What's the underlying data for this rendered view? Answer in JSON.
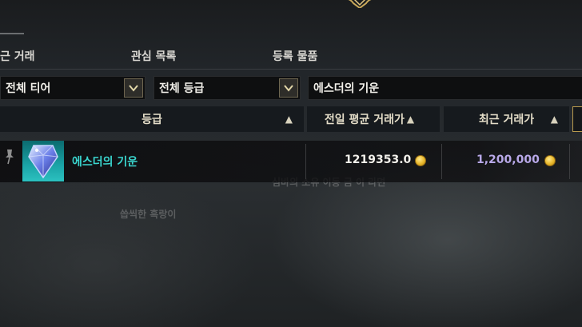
{
  "tabs": [
    {
      "label": "근 거래"
    },
    {
      "label": "관심 목록"
    },
    {
      "label": "등록 물품"
    }
  ],
  "filters": {
    "tier": "전체 티어",
    "grade": "전체 등급",
    "search_value": "에스더의 기운"
  },
  "columns": {
    "grade": "등급",
    "prev_avg_price": "전일 평균 거래가",
    "recent_price": "최근 거래가",
    "sort_icon": "▲"
  },
  "rows": [
    {
      "name": "에스더의 기운",
      "prev_avg_price": "1219353.0",
      "recent_price": "1,200,000",
      "icon": "esther-crystal-icon"
    }
  ],
  "background_text": {
    "line1": "심바의 소유 이동 금 이 라면",
    "line2": "씁씩한 흑랑이"
  },
  "colors": {
    "item_name": "#3ad7d0",
    "recent_price": "#b8a8e8",
    "accent_gold": "#e7b72b"
  }
}
